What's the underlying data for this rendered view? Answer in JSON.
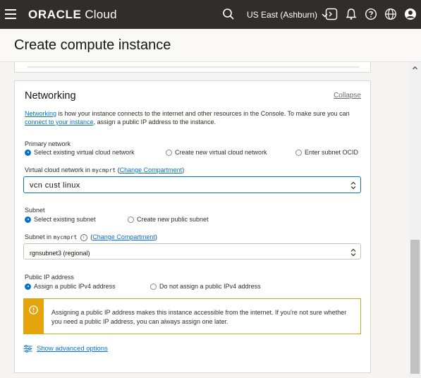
{
  "topbar": {
    "brand_bold": "ORACLE",
    "brand_light": "Cloud",
    "region": "US East (Ashburn)",
    "icons": [
      "menu-icon",
      "search-icon",
      "chevron-down-icon",
      "cloud-shell-icon",
      "bell-icon",
      "help-icon",
      "globe-icon",
      "user-icon"
    ]
  },
  "header": {
    "title": "Create compute instance"
  },
  "networking": {
    "title": "Networking",
    "collapse": "Collapse",
    "desc_link1": "Networking",
    "desc_text1": " is how your instance connects to the internet and other resources in the Console. To make sure you can ",
    "desc_link2": "connect to your instance",
    "desc_text2": ", assign a public IP address to the instance.",
    "primary_network": {
      "label": "Primary network",
      "options": [
        "Select existing virtual cloud network",
        "Create new virtual cloud network",
        "Enter subnet OCID"
      ],
      "selected": 0
    },
    "vcn": {
      "label": "Virtual cloud network in",
      "compartment": "mycmprt",
      "change_prefix": "(",
      "change_link": "Change Compartment",
      "change_suffix": ")",
      "value": "vcn  cust  linux"
    },
    "subnet": {
      "label": "Subnet",
      "options": [
        "Select existing subnet",
        "Create new public subnet"
      ],
      "selected": 0
    },
    "subnet_in": {
      "label": "Subnet in",
      "compartment": "mycmprt",
      "info": "i",
      "change_prefix": "(",
      "change_link": "Change Compartment",
      "change_suffix": ")",
      "value": "rgnsubnet3 (regional)"
    },
    "public_ip": {
      "label": "Public IP address",
      "options": [
        "Assign a public IPv4 address",
        "Do not assign a public IPv4 address"
      ],
      "selected": 0
    },
    "warning": {
      "icon": "alert-icon",
      "text": "Assigning a public IP address makes this instance accessible from the internet. If you're not sure whether you need a public IP address, you can always assign one later."
    },
    "advanced": "Show advanced options"
  },
  "colors": {
    "accent": "#0572ce",
    "warning": "#e6a40c",
    "topbar": "#312d2a"
  }
}
